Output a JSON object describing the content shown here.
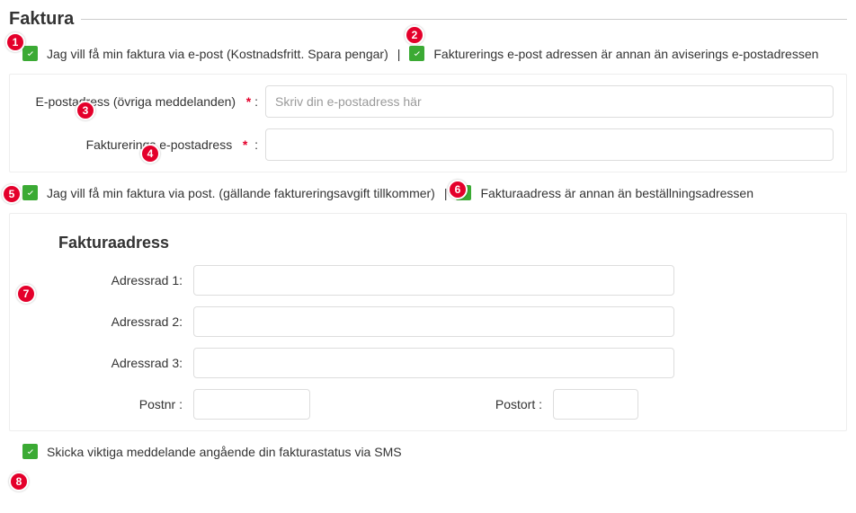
{
  "header": {
    "title": "Faktura"
  },
  "checks": {
    "email_invoice_label": "Jag vill få min faktura via e-post (Kostnadsfritt. Spara pengar)",
    "email_diff_label": "Fakturerings e-post adressen är annan än aviserings e-postadressen",
    "postal_invoice_label": "Jag vill få min faktura via post. (gällande faktureringsavgift tillkommer)",
    "address_diff_label": "Fakturaadress är annan än beställningsadressen",
    "sms_label": "Skicka viktiga meddelande angående din fakturastatus via SMS",
    "separator": "|"
  },
  "fields": {
    "email_label": "E-postadress  (övriga meddelanden)",
    "email_req": "*",
    "email_colon": ":",
    "email_placeholder": "Skriv din e-postadress här",
    "invoice_email_label": "Fakturerings e-postadress",
    "invoice_email_req": "*",
    "invoice_email_colon": ":"
  },
  "address": {
    "title": "Fakturaadress",
    "row1_label": "Adressrad 1:",
    "row2_label": "Adressrad 2:",
    "row3_label": "Adressrad 3:",
    "postnr_label": "Postnr :",
    "postort_label": "Postort :"
  },
  "badges": {
    "1": "1",
    "2": "2",
    "3": "3",
    "4": "4",
    "5": "5",
    "6": "6",
    "7": "7",
    "8": "8"
  }
}
